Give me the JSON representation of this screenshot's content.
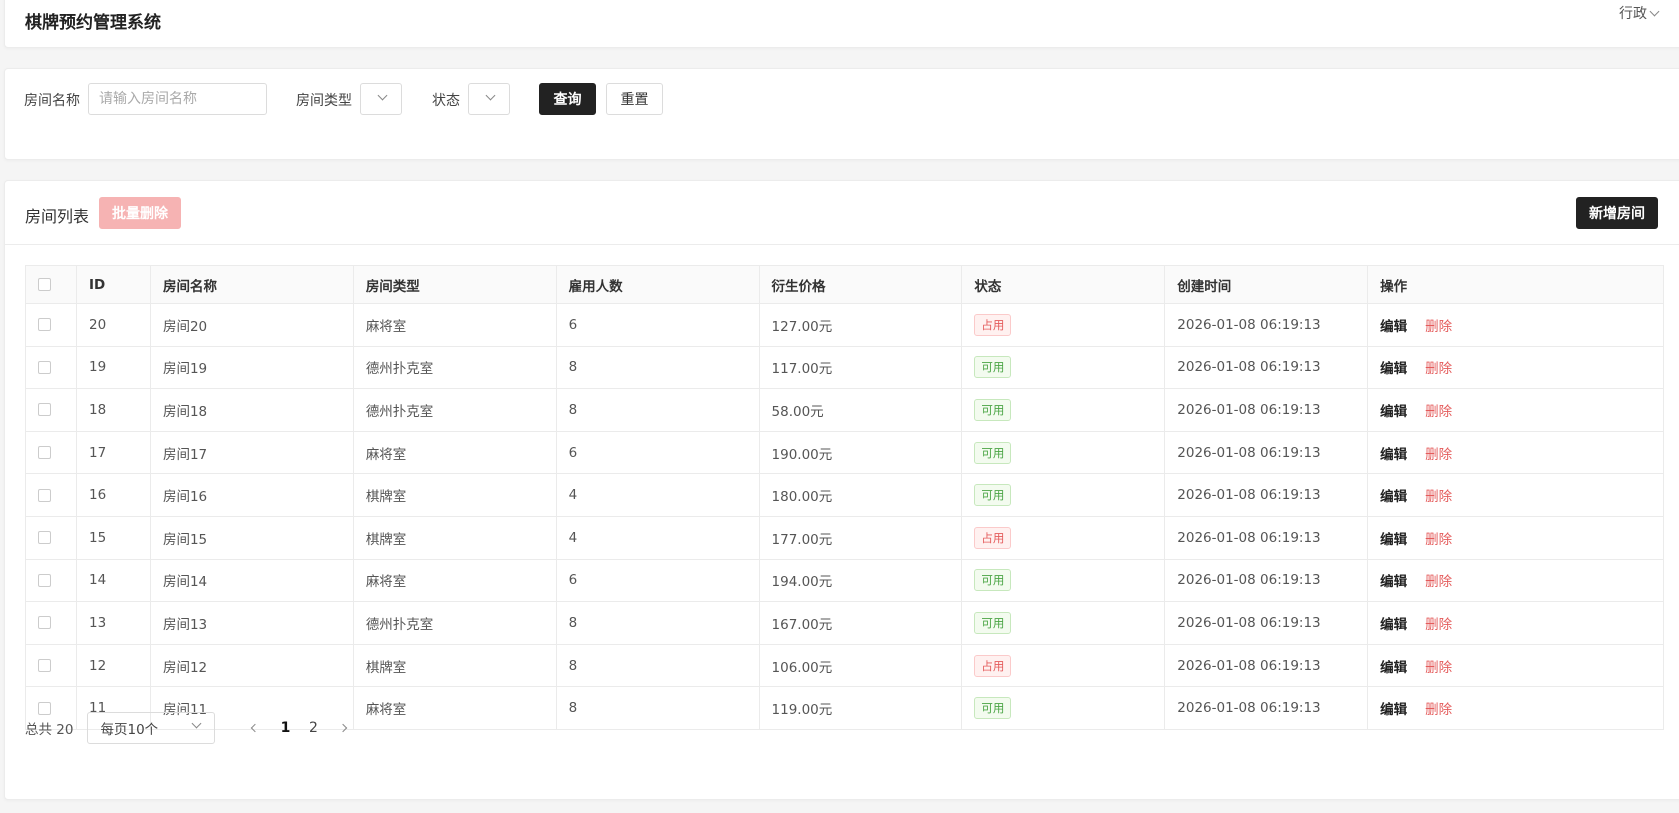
{
  "header": {
    "title": "棋牌预约管理系统",
    "user": "行政"
  },
  "search": {
    "room_name_label": "房间名称",
    "room_name_placeholder": "请输入房间名称",
    "room_type_label": "房间类型",
    "status_label": "状态",
    "query_label": "查询",
    "reset_label": "重置"
  },
  "list": {
    "title": "房间列表",
    "batch_delete_label": "批量删除",
    "add_label": "新增房间",
    "columns": [
      "ID",
      "房间名称",
      "房间类型",
      "雇用人数",
      "衍生价格",
      "状态",
      "创建时间",
      "操作"
    ],
    "rows": [
      {
        "id": "20",
        "name": "房间20",
        "type": "麻将室",
        "staff": "6",
        "price": "127.00元",
        "status": "占用",
        "created": "2026-01-08 06:19:13"
      },
      {
        "id": "19",
        "name": "房间19",
        "type": "德州扑克室",
        "staff": "8",
        "price": "117.00元",
        "status": "可用",
        "created": "2026-01-08 06:19:13"
      },
      {
        "id": "18",
        "name": "房间18",
        "type": "德州扑克室",
        "staff": "8",
        "price": "58.00元",
        "status": "可用",
        "created": "2026-01-08 06:19:13"
      },
      {
        "id": "17",
        "name": "房间17",
        "type": "麻将室",
        "staff": "6",
        "price": "190.00元",
        "status": "可用",
        "created": "2026-01-08 06:19:13"
      },
      {
        "id": "16",
        "name": "房间16",
        "type": "棋牌室",
        "staff": "4",
        "price": "180.00元",
        "status": "可用",
        "created": "2026-01-08 06:19:13"
      },
      {
        "id": "15",
        "name": "房间15",
        "type": "棋牌室",
        "staff": "4",
        "price": "177.00元",
        "status": "占用",
        "created": "2026-01-08 06:19:13"
      },
      {
        "id": "14",
        "name": "房间14",
        "type": "麻将室",
        "staff": "6",
        "price": "194.00元",
        "status": "可用",
        "created": "2026-01-08 06:19:13"
      },
      {
        "id": "13",
        "name": "房间13",
        "type": "德州扑克室",
        "staff": "8",
        "price": "167.00元",
        "status": "可用",
        "created": "2026-01-08 06:19:13"
      },
      {
        "id": "12",
        "name": "房间12",
        "type": "棋牌室",
        "staff": "8",
        "price": "106.00元",
        "status": "占用",
        "created": "2026-01-08 06:19:13"
      },
      {
        "id": "11",
        "name": "房间11",
        "type": "麻将室",
        "staff": "8",
        "price": "119.00元",
        "status": "可用",
        "created": "2026-01-08 06:19:13"
      }
    ],
    "edit_label": "编辑",
    "delete_label": "删除"
  },
  "pagination": {
    "total": "总共 20",
    "page_size": "每页10个",
    "pages": [
      "1",
      "2"
    ],
    "current": "1"
  },
  "colors": {
    "primary": "#222222",
    "danger": "#e45b5b",
    "success": "#4aa544",
    "danger_disabled": "#f6b3b3"
  }
}
